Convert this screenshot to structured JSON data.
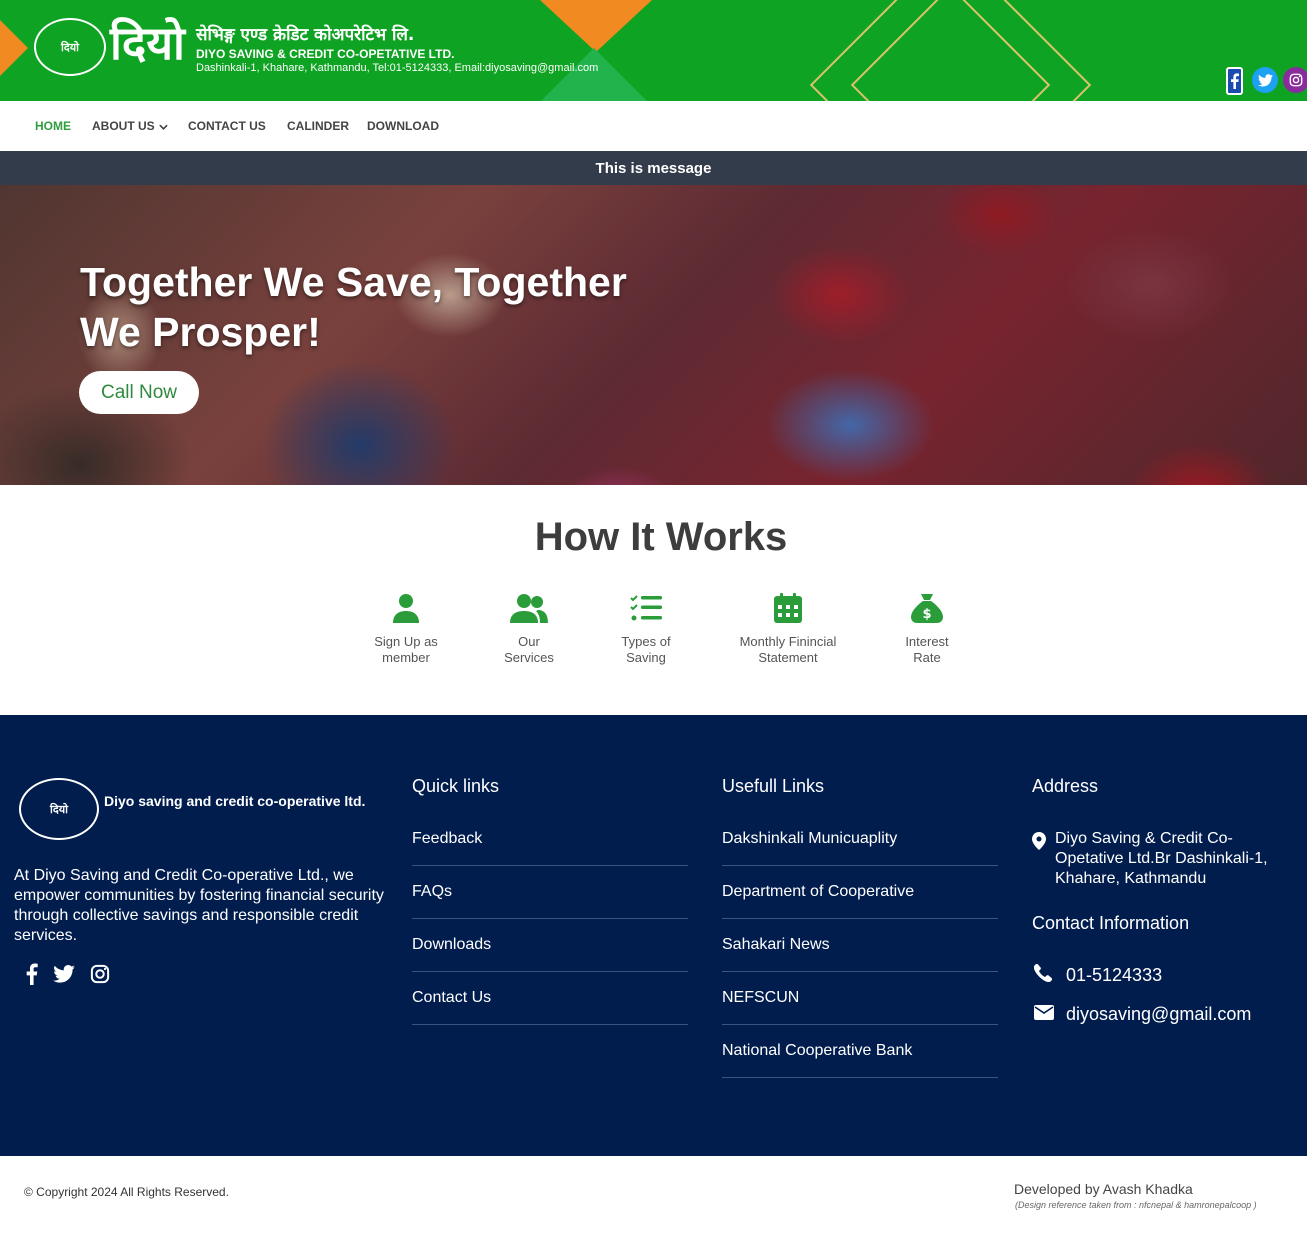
{
  "header": {
    "logo_seal": "दियो",
    "logo_big": "दियो",
    "name_np": "सेभिङ्ग एण्ड क्रेडिट कोअपरेटिभ लि.",
    "name_en": "DIYO SAVING & CREDIT CO-OPETATIVE LTD.",
    "address": "Dashinkali-1, Khahare, Kathmandu, Tel:01-5124333, Email:diyosaving@gmail.com",
    "social": [
      "facebook-icon",
      "twitter-icon",
      "instagram-icon"
    ]
  },
  "nav": {
    "items": [
      {
        "label": "HOME"
      },
      {
        "label": "ABOUT US"
      },
      {
        "label": "CONTACT US"
      },
      {
        "label": "CALINDER"
      },
      {
        "label": "DOWNLOAD"
      }
    ]
  },
  "message": "This is message",
  "hero": {
    "title": "Together We Save, Together We Prosper!",
    "button": "Call Now"
  },
  "how_it_works": {
    "title": "How It Works",
    "items": [
      {
        "label": "Sign Up as member",
        "icon": "user-icon"
      },
      {
        "label": "Our Services",
        "icon": "users-icon"
      },
      {
        "label": "Types of Saving",
        "icon": "list-check-icon"
      },
      {
        "label": "Monthly Finincial Statement",
        "icon": "calendar-icon"
      },
      {
        "label": "Interest Rate",
        "icon": "money-bag-icon"
      }
    ]
  },
  "footer": {
    "logo_seal": "दियो",
    "org_name": "Diyo saving and credit co-operative ltd.",
    "about": "At Diyo Saving and Credit Co-operative Ltd., we empower communities by fostering financial security through collective savings and responsible credit services.",
    "quick_links_title": "Quick links",
    "quick_links": [
      "Feedback",
      "FAQs",
      "Downloads",
      "Contact Us"
    ],
    "useful_links_title": "Usefull Links",
    "useful_links": [
      "Dakshinkali Municuaplity",
      "Department of Cooperative",
      "Sahakari News",
      "NEFSCUN",
      "National Cooperative Bank"
    ],
    "address_title": "Address",
    "address": "Diyo Saving & Credit Co-Opetative Ltd.Br Dashinkali-1, Khahare, Kathmandu",
    "contact_title": "Contact Information",
    "phone": "01-5124333",
    "email": "diyosaving@gmail.com"
  },
  "bottom": {
    "copyright": "© Copyright 2024 All Rights Reserved.",
    "developer": "Developed by Avash Khadka",
    "design_note": "(Design reference taken from : nfcnepal & hamronepalcoop )"
  },
  "colors": {
    "header_green": "#0ea322",
    "accent_orange": "#f28a22",
    "nav_active": "#2f9e3f",
    "message_bar": "#333c4b",
    "icon_green": "#2a9d3a",
    "footer_navy": "#001d4d"
  }
}
